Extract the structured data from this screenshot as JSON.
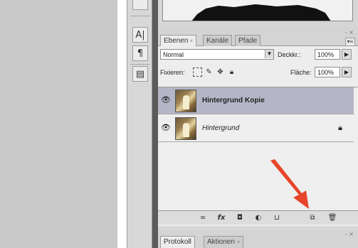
{
  "layers_panel": {
    "tabs": [
      {
        "label": "Ebenen",
        "close": "×",
        "active": true
      },
      {
        "label": "Kanäle",
        "close": "",
        "active": false
      },
      {
        "label": "Pfade",
        "close": "",
        "active": false
      }
    ],
    "corner_controls": "- ×",
    "menu_glyph": "▾≡",
    "blend_mode": "Normal",
    "opacity_label": "Deckkr.:",
    "opacity_value": "100%",
    "lock_label": "Fixieren:",
    "fill_label": "Fläche:",
    "fill_value": "100%",
    "layers": [
      {
        "name": "Hintergrund Kopie",
        "selected": true,
        "locked": false
      },
      {
        "name": "Hintergrund",
        "selected": false,
        "locked": true
      }
    ]
  },
  "history_panel": {
    "tabs": [
      {
        "label": "Protokoll",
        "active": true
      },
      {
        "label": "Aktionen",
        "close": "×",
        "active": false
      }
    ],
    "corner_controls": "- ×"
  },
  "icons": {
    "tool_buttons": [
      "type-icon",
      "paragraph-icon",
      "notes-icon"
    ],
    "footer_buttons": [
      "link-layers-icon",
      "fx-icon",
      "add-mask-icon",
      "adjustment-layer-icon",
      "new-group-icon",
      "new-layer-icon",
      "delete-layer-icon"
    ]
  },
  "colors": {
    "selected_row": "#b4b6c6",
    "annotation_arrow": "#e8442a"
  }
}
